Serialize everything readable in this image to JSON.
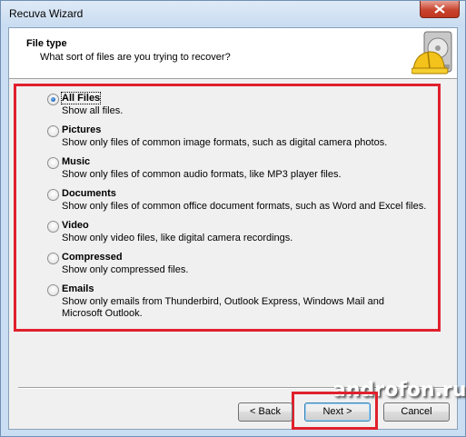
{
  "window": {
    "title": "Recuva Wizard"
  },
  "header": {
    "title": "File type",
    "subtitle": "What sort of files are you trying to recover?",
    "icon": "hard-hat-drive-icon"
  },
  "options": [
    {
      "label": "All Files",
      "description": "Show all files.",
      "selected": true
    },
    {
      "label": "Pictures",
      "description": "Show only files of common image formats, such as digital camera photos.",
      "selected": false
    },
    {
      "label": "Music",
      "description": "Show only files of common audio formats, like MP3 player files.",
      "selected": false
    },
    {
      "label": "Documents",
      "description": "Show only files of common office document formats, such as Word and Excel files.",
      "selected": false
    },
    {
      "label": "Video",
      "description": "Show only video files, like digital camera recordings.",
      "selected": false
    },
    {
      "label": "Compressed",
      "description": "Show only compressed files.",
      "selected": false
    },
    {
      "label": "Emails",
      "description": "Show only emails from Thunderbird, Outlook Express, Windows Mail and Microsoft Outlook.",
      "selected": false
    }
  ],
  "buttons": {
    "back": "< Back",
    "next": "Next >",
    "cancel": "Cancel"
  },
  "watermark": "androfon.ru",
  "colors": {
    "highlight": "#e0202c",
    "frame": "#c9def3",
    "close": "#c8452f"
  }
}
